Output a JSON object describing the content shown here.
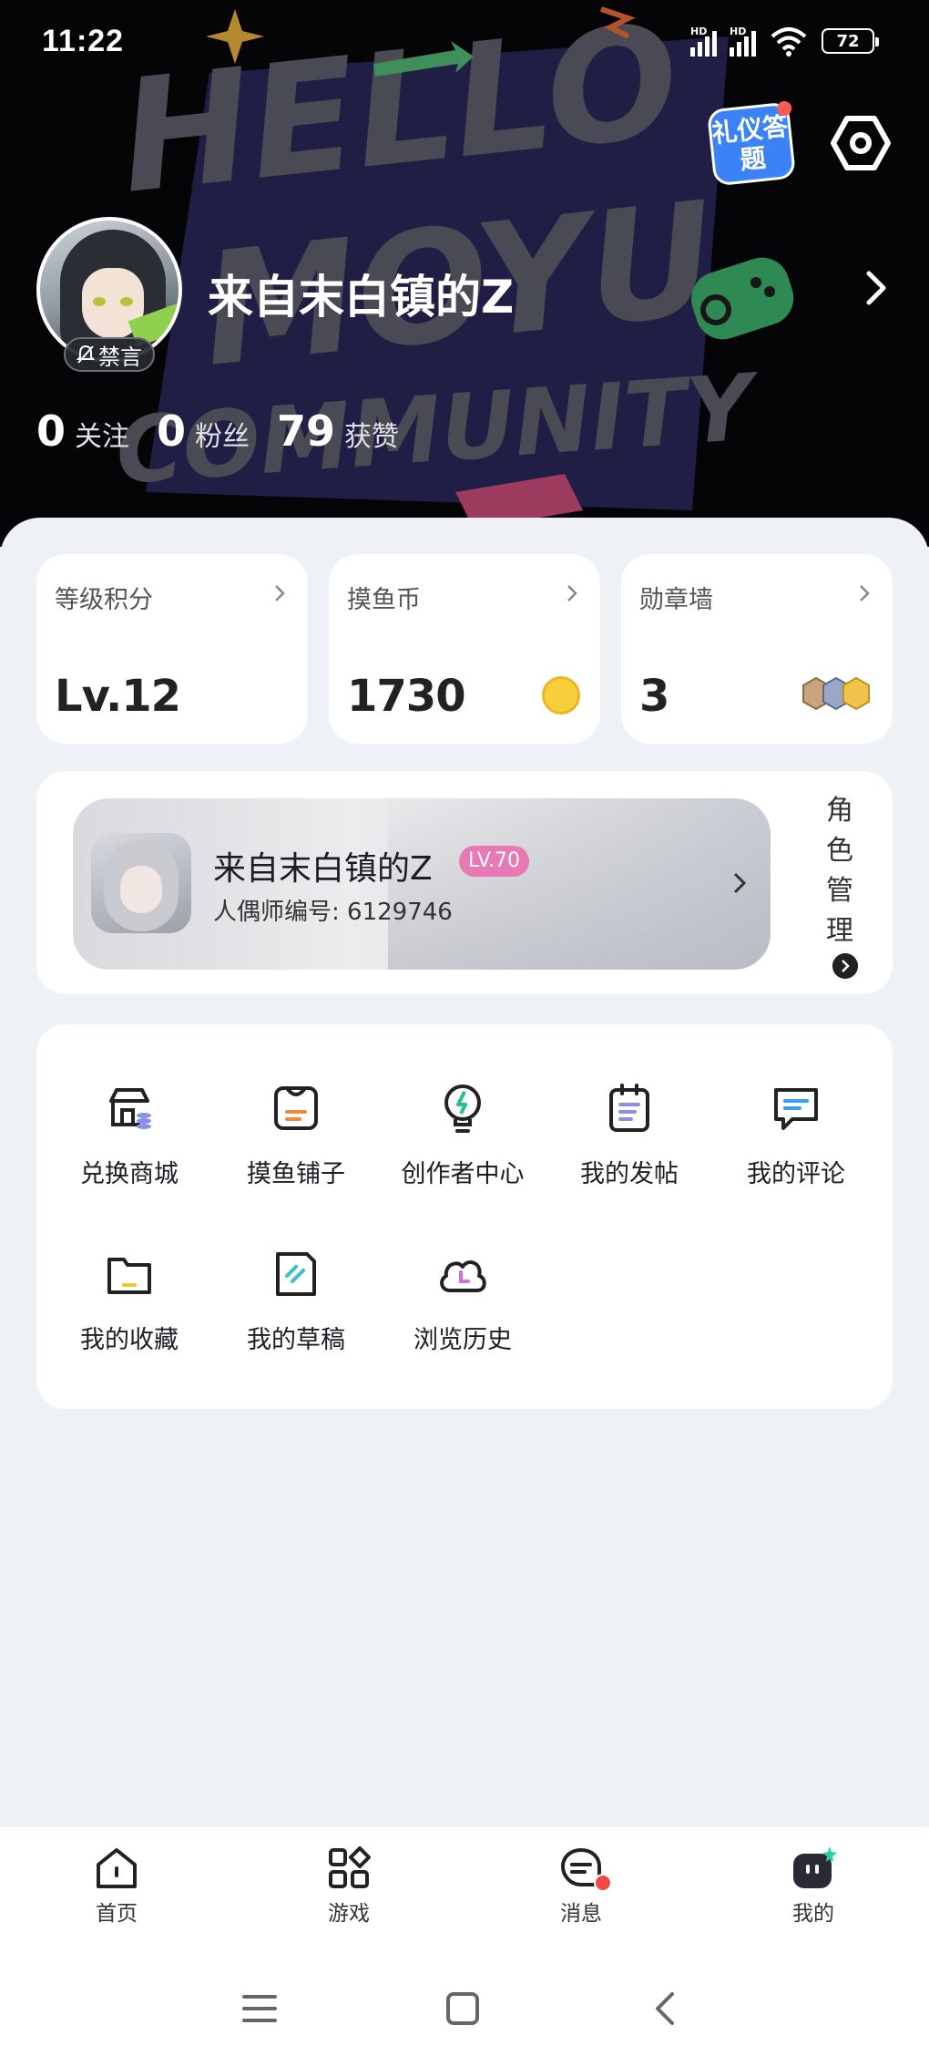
{
  "status_bar": {
    "time": "11:22",
    "signal_1_label": "HD",
    "signal_2_label": "HD",
    "battery": "72"
  },
  "header": {
    "quiz_badge": "礼仪答题",
    "username": "来自末白镇的Z",
    "mute_tag": "禁言",
    "stats": [
      {
        "value": "0",
        "label": "关注"
      },
      {
        "value": "0",
        "label": "粉丝"
      },
      {
        "value": "79",
        "label": "获赞"
      }
    ]
  },
  "cards": {
    "level": {
      "title": "等级积分",
      "value": "Lv.12"
    },
    "coins": {
      "title": "摸鱼币",
      "value": "1730",
      "icon": "coin-icon"
    },
    "medals": {
      "title": "勋章墙",
      "value": "3",
      "icon": "medal-icon"
    }
  },
  "role": {
    "name": "来自末白镇的Z",
    "level": "LV.70",
    "id_line": "人偶师编号: 6129746",
    "manage_label": [
      "角",
      "色",
      "管",
      "理"
    ]
  },
  "menu": {
    "items": [
      {
        "label": "兑换商城",
        "icon": "shop-icon"
      },
      {
        "label": "摸鱼铺子",
        "icon": "store-icon"
      },
      {
        "label": "创作者中心",
        "icon": "bulb-icon"
      },
      {
        "label": "我的发帖",
        "icon": "post-icon"
      },
      {
        "label": "我的评论",
        "icon": "comment-icon"
      },
      {
        "label": "我的收藏",
        "icon": "folder-icon"
      },
      {
        "label": "我的草稿",
        "icon": "draft-icon"
      },
      {
        "label": "浏览历史",
        "icon": "history-icon"
      }
    ]
  },
  "bottom_nav": {
    "items": [
      {
        "label": "首页",
        "icon": "home-icon"
      },
      {
        "label": "游戏",
        "icon": "games-icon"
      },
      {
        "label": "消息",
        "icon": "message-icon"
      },
      {
        "label": "我的",
        "icon": "profile-icon"
      }
    ]
  },
  "colors": {
    "accent_pink": "#e879b4",
    "badge_blue": "#3b82f6",
    "coin_gold": "#f7cf3a",
    "notif_red": "#f04848"
  }
}
